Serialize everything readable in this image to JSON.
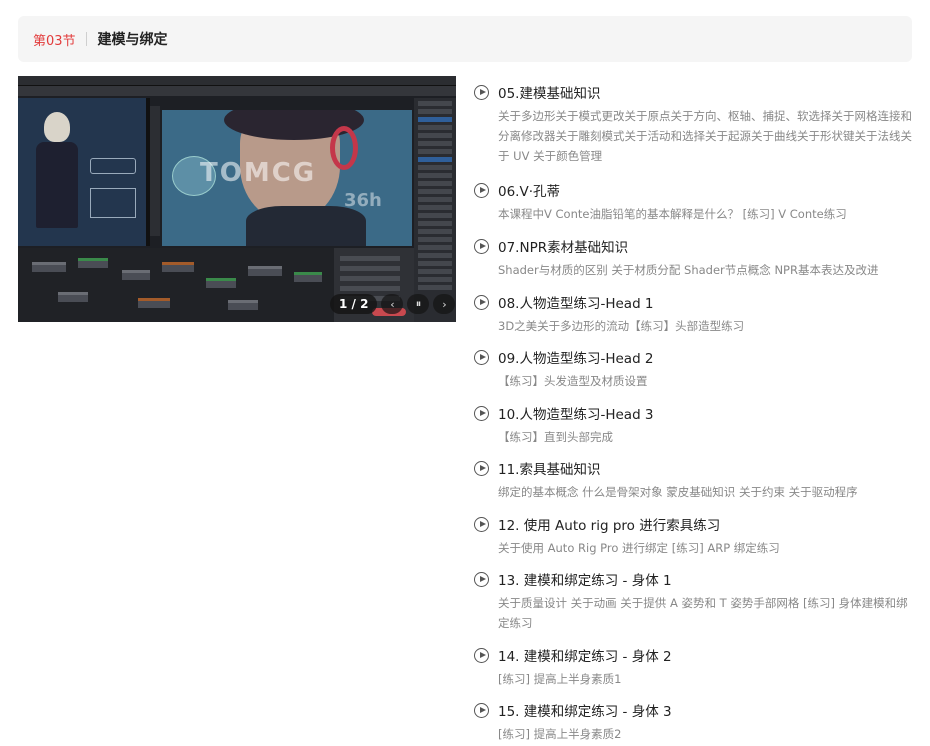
{
  "section": {
    "number": "第03节",
    "title": "建模与绑定"
  },
  "preview": {
    "watermark": "TOMCG",
    "timer": "36h",
    "pager": {
      "count": "1 / 2",
      "prev": "‹",
      "pause": "⏸",
      "next": "›"
    }
  },
  "lessons": [
    {
      "title": "05.建模基础知识",
      "desc": "关于多边形关于模式更改关于原点关于方向、枢轴、捕捉、软选择关于网格连接和分离修改器关于雕刻模式关于活动和选择关于起源关于曲线关于形状键关于法线关于 UV 关于颜色管理"
    },
    {
      "title": "06.V·孔蒂",
      "desc": "本课程中V Conte油脂铅笔的基本解释是什么？ [练习] V Conte练习"
    },
    {
      "title": "07.NPR素材基础知识",
      "desc": "Shader与材质的区别 关于材质分配 Shader节点概念 NPR基本表达及改进"
    },
    {
      "title": "08.人物造型练习-Head 1",
      "desc": "3D之美关于多边形的流动【练习】头部造型练习"
    },
    {
      "title": "09.人物造型练习-Head 2",
      "desc": "【练习】头发造型及材质设置"
    },
    {
      "title": "10.人物造型练习-Head 3",
      "desc": "【练习】直到头部完成"
    },
    {
      "title": "11.索具基础知识",
      "desc": "绑定的基本概念 什么是骨架对象 蒙皮基础知识 关于约束 关于驱动程序"
    },
    {
      "title": "12. 使用 Auto rig pro 进行索具练习",
      "desc": "关于使用 Auto Rig Pro 进行绑定 [练习] ARP 绑定练习"
    },
    {
      "title": "13. 建模和绑定练习 - 身体 1",
      "desc": "关于质量设计 关于动画 关于提供 A 姿势和 T 姿势手部网格 [练习] 身体建模和绑定练习"
    },
    {
      "title": "14. 建模和绑定练习 - 身体 2",
      "desc": "[练习] 提高上半身素质1"
    },
    {
      "title": "15. 建模和绑定练习 - 身体 3",
      "desc": "[练习] 提高上半身素质2"
    }
  ]
}
